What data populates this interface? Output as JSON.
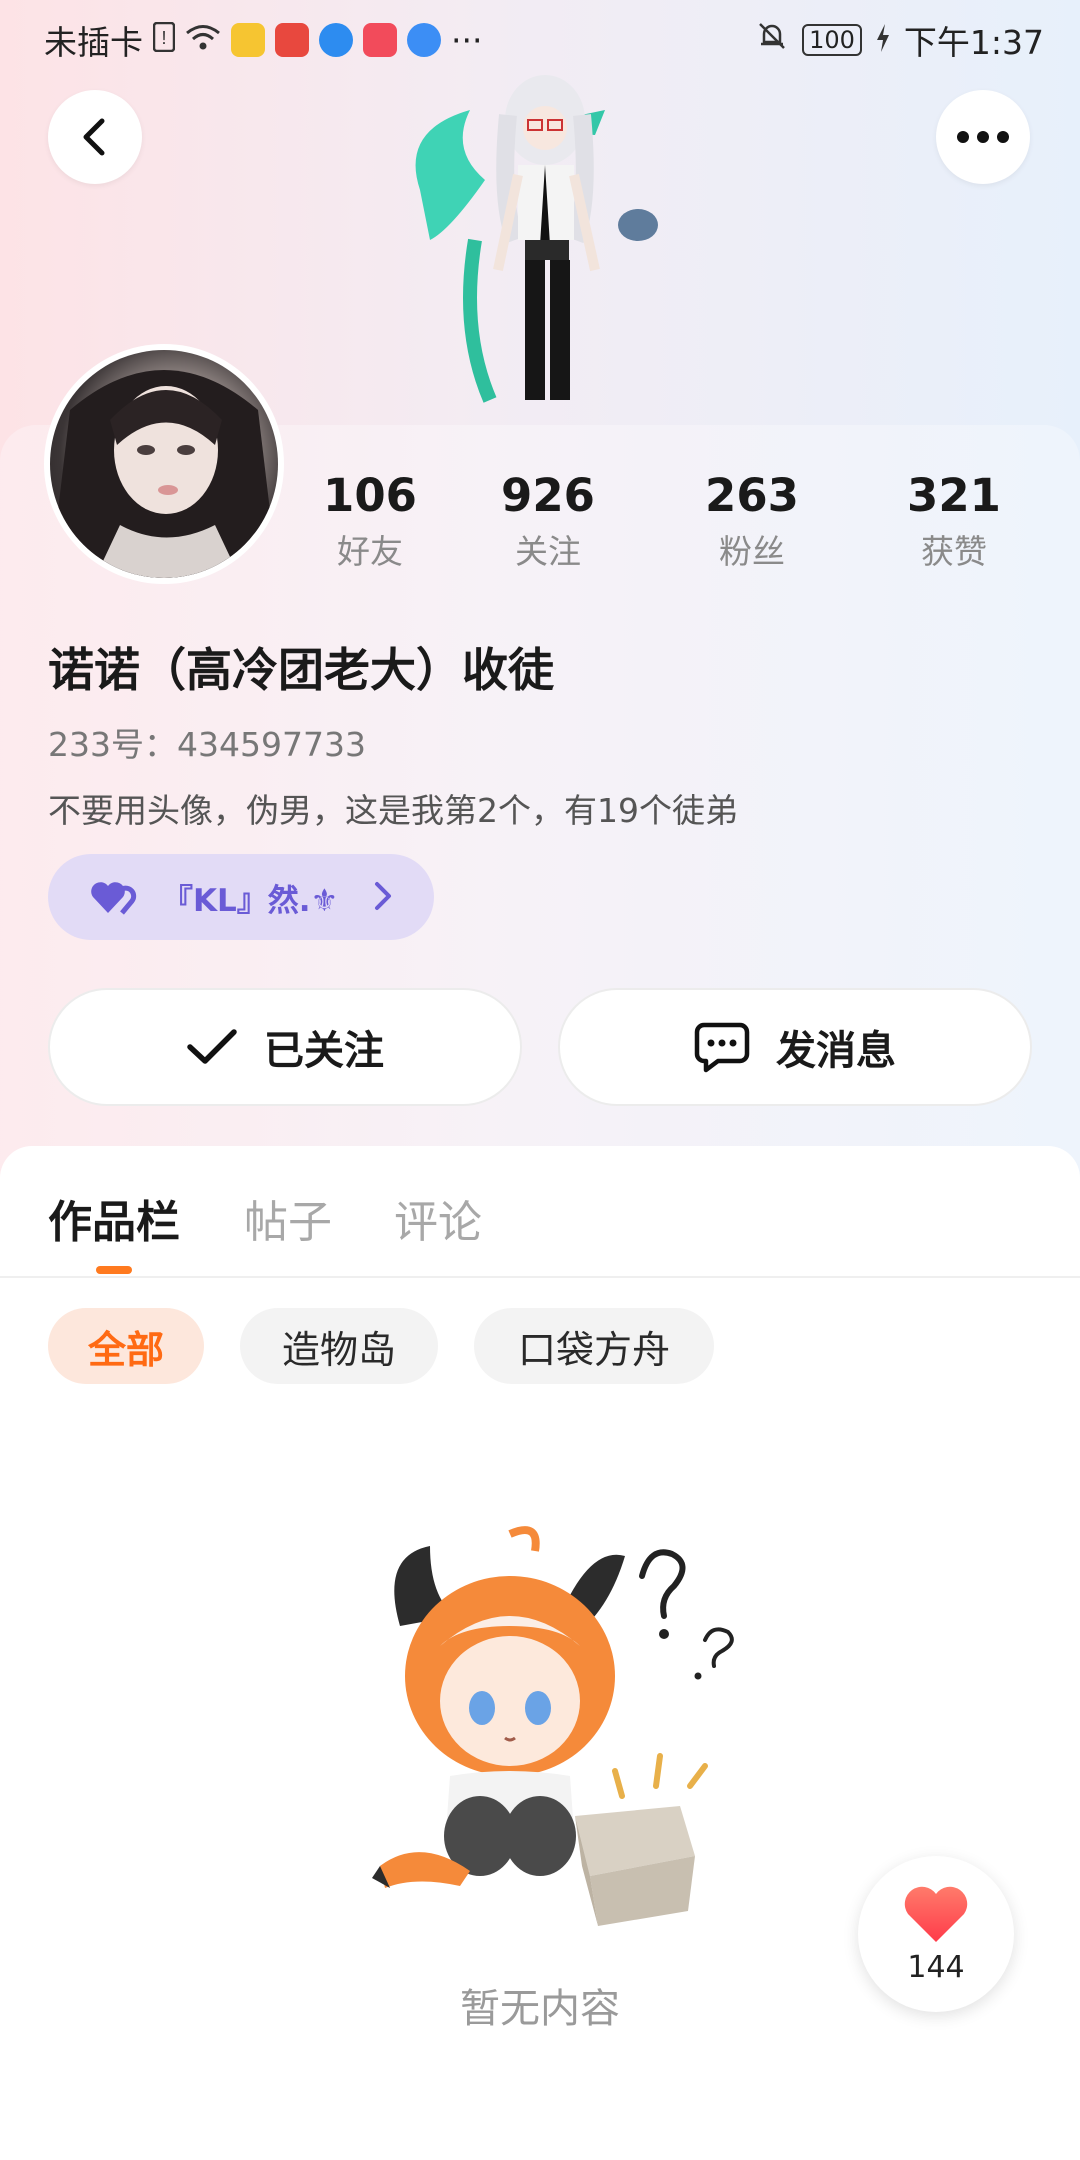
{
  "status_bar": {
    "carrier": "未插卡",
    "battery": "100",
    "time": "下午1:37",
    "more": "···"
  },
  "profile": {
    "stats": [
      {
        "value": "106",
        "label": "好友"
      },
      {
        "value": "926",
        "label": "关注"
      },
      {
        "value": "263",
        "label": "粉丝"
      },
      {
        "value": "321",
        "label": "获赞"
      }
    ],
    "name": "诺诺（高冷团老大）收徒",
    "uid": "233号：434597733",
    "bio": "不要用头像，伪男，这是我第2个，有19个徒弟",
    "tag": "『KL』然.⚜"
  },
  "actions": {
    "follow": "已关注",
    "message": "发消息"
  },
  "tabs": [
    "作品栏",
    "帖子",
    "评论"
  ],
  "filters": [
    "全部",
    "造物岛",
    "口袋方舟"
  ],
  "empty": {
    "text": "暂无内容"
  },
  "like_fab": {
    "count": "144"
  },
  "colors": {
    "accent": "#ff7a1f",
    "tag_text": "#6a5bd6",
    "like": "#ff4d4d"
  }
}
